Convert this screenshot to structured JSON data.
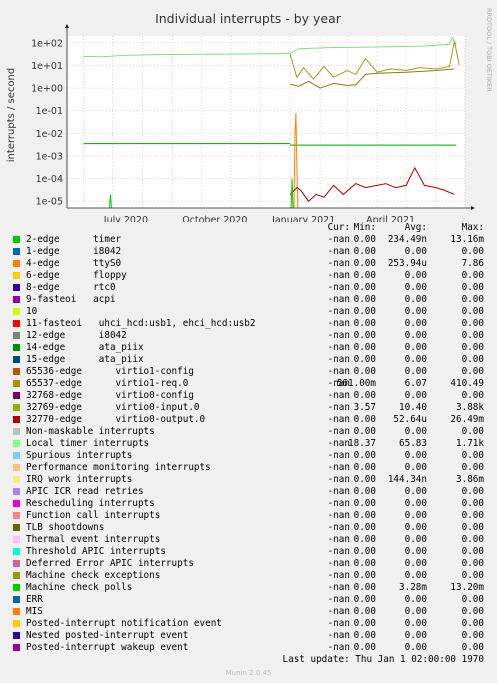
{
  "chart_data": {
    "type": "line",
    "title": "Individual interrupts - by year",
    "ylabel": "interrupts / second",
    "side_label": "RRDTOOL / TOBI OETIKER",
    "y_scale": "log",
    "ylim": [
      5e-06,
      200
    ],
    "y_ticks": [
      "1e+02",
      "1e+01",
      "1e+00",
      "1e-01",
      "1e-02",
      "1e-03",
      "1e-04",
      "1e-05"
    ],
    "x_ticks": [
      "July 2020",
      "October 2020",
      "January 2021",
      "April 2021"
    ],
    "xlim": [
      "2020-05-15",
      "2021-07-01"
    ],
    "series": [
      {
        "name": "Local timer interrupts",
        "color": "#7fe07f",
        "segments": [
          {
            "x": [
              "2020-06-01",
              "2020-06-20",
              "2020-07-15",
              "2020-08-20",
              "2020-10-01",
              "2020-11-15",
              "2020-12-15",
              "2021-01-01",
              "2021-01-10",
              "2021-02-15",
              "2021-04-01",
              "2021-05-15",
              "2021-06-15",
              "2021-06-18",
              "2021-06-22"
            ],
            "y": [
              25,
              24,
              28,
              30,
              31,
              32,
              33,
              34,
              55,
              62,
              65,
              70,
              85,
              170,
              80
            ]
          }
        ]
      },
      {
        "name": "virtio1-req.0",
        "color": "#a09c20",
        "segments": [
          {
            "x": [
              "2021-01-01",
              "2021-01-08",
              "2021-01-15",
              "2021-01-25",
              "2021-02-05",
              "2021-02-15",
              "2021-03-01",
              "2021-03-10",
              "2021-03-20",
              "2021-04-01",
              "2021-04-15",
              "2021-05-01",
              "2021-05-15",
              "2021-06-01",
              "2021-06-15",
              "2021-06-20",
              "2021-06-25"
            ],
            "y": [
              30,
              3,
              8,
              2.5,
              9,
              3,
              6,
              4,
              20,
              5,
              7,
              6,
              8,
              7,
              9,
              120,
              10
            ]
          }
        ]
      },
      {
        "name": "virtio0-input.0",
        "color": "#8a7a10",
        "segments": [
          {
            "x": [
              "2021-01-01",
              "2021-01-10",
              "2021-01-20",
              "2021-02-01",
              "2021-02-15",
              "2021-03-01",
              "2021-03-10",
              "2021-03-20",
              "2021-04-01",
              "2021-05-01",
              "2021-06-01",
              "2021-06-20"
            ],
            "y": [
              1.5,
              1.2,
              2,
              1,
              1.6,
              1.3,
              1.4,
              4,
              4.5,
              5,
              6,
              7
            ]
          }
        ]
      },
      {
        "name": "timer",
        "color": "#00a000",
        "segments": [
          {
            "x": [
              "2020-06-01",
              "2021-01-01"
            ],
            "y": [
              0.0035,
              0.0035
            ]
          },
          {
            "x": [
              "2021-01-01",
              "2021-06-22"
            ],
            "y": [
              0.003,
              0.003
            ]
          }
        ]
      },
      {
        "name": "ttyS0",
        "color": "#ff8000",
        "segments": [
          {
            "x": [
              "2021-01-05",
              "2021-01-06",
              "2021-01-07",
              "2021-01-08",
              "2021-01-09"
            ],
            "y": [
              5e-06,
              0.01,
              0.08,
              0.0003,
              5e-06
            ]
          }
        ]
      },
      {
        "name": "virtio0-output.0",
        "color": "#aa0000",
        "segments": [
          {
            "x": [
              "2021-01-01",
              "2021-01-08",
              "2021-01-12",
              "2021-01-20",
              "2021-01-28",
              "2021-02-05",
              "2021-02-15",
              "2021-02-25",
              "2021-03-10",
              "2021-03-20",
              "2021-04-01",
              "2021-04-10",
              "2021-04-20",
              "2021-05-01",
              "2021-05-10",
              "2021-05-20",
              "2021-06-01",
              "2021-06-10",
              "2021-06-20"
            ],
            "y": [
              2e-05,
              4e-05,
              3e-05,
              1e-05,
              2e-05,
              1.5e-05,
              5e-05,
              2e-05,
              6e-05,
              4e-05,
              5e-05,
              6e-05,
              4e-05,
              5e-05,
              0.0003,
              5e-05,
              4e-05,
              3e-05,
              2e-05
            ]
          }
        ]
      },
      {
        "name": "12-edge",
        "color": "#00cc00",
        "segments": [
          {
            "x": [
              "2020-06-28",
              "2020-06-29",
              "2020-06-30"
            ],
            "y": [
              5e-06,
              2e-05,
              5e-06
            ]
          },
          {
            "x": [
              "2021-01-02",
              "2021-01-03",
              "2021-01-04"
            ],
            "y": [
              5e-06,
              0.0001,
              5e-06
            ]
          }
        ]
      }
    ]
  },
  "legend": {
    "headers": {
      "cur": "Cur:",
      "min": "Min:",
      "avg": "Avg:",
      "max": "Max:"
    },
    "rows": [
      {
        "name": "2-edge      timer",
        "color": "#00cc00",
        "cur": "-nan",
        "min": "0.00",
        "avg": "234.49n",
        "max": "13.16m"
      },
      {
        "name": "1-edge      i8042",
        "color": "#0066b3",
        "cur": "-nan",
        "min": "0.00",
        "avg": "0.00",
        "max": "0.00"
      },
      {
        "name": "4-edge      ttyS0",
        "color": "#ff8000",
        "cur": "-nan",
        "min": "0.00",
        "avg": "253.94u",
        "max": "7.86"
      },
      {
        "name": "6-edge      floppy",
        "color": "#ffcc00",
        "cur": "-nan",
        "min": "0.00",
        "avg": "0.00",
        "max": "0.00"
      },
      {
        "name": "8-edge      rtc0",
        "color": "#330099",
        "cur": "-nan",
        "min": "0.00",
        "avg": "0.00",
        "max": "0.00"
      },
      {
        "name": "9-fasteoi   acpi",
        "color": "#990099",
        "cur": "-nan",
        "min": "0.00",
        "avg": "0.00",
        "max": "0.00"
      },
      {
        "name": "10",
        "color": "#ccff00",
        "cur": "-nan",
        "min": "0.00",
        "avg": "0.00",
        "max": "0.00"
      },
      {
        "name": "11-fasteoi   uhci_hcd:usb1, ehci_hcd:usb2",
        "color": "#ff0000",
        "cur": "-nan",
        "min": "0.00",
        "avg": "0.00",
        "max": "0.00"
      },
      {
        "name": "12-edge      i8042",
        "color": "#808080",
        "cur": "-nan",
        "min": "0.00",
        "avg": "0.00",
        "max": "0.00"
      },
      {
        "name": "14-edge      ata_piix",
        "color": "#008f00",
        "cur": "-nan",
        "min": "0.00",
        "avg": "0.00",
        "max": "0.00"
      },
      {
        "name": "15-edge      ata_piix",
        "color": "#00487d",
        "cur": "-nan",
        "min": "0.00",
        "avg": "0.00",
        "max": "0.00"
      },
      {
        "name": "65536-edge      virtio1-config",
        "color": "#b35a00",
        "cur": "-nan",
        "min": "0.00",
        "avg": "0.00",
        "max": "0.00"
      },
      {
        "name": "65537-edge      virtio1-req.0",
        "color": "#b38f00",
        "cur": "-nan",
        "min": "561.00m",
        "avg": "6.07",
        "max": "410.49"
      },
      {
        "name": "32768-edge      virtio0-config",
        "color": "#6b006b",
        "cur": "-nan",
        "min": "0.00",
        "avg": "0.00",
        "max": "0.00"
      },
      {
        "name": "32769-edge      virtio0-input.0",
        "color": "#8fb300",
        "cur": "-nan",
        "min": "3.57",
        "avg": "10.40",
        "max": "3.88k"
      },
      {
        "name": "32770-edge      virtio0-output.0",
        "color": "#b30000",
        "cur": "-nan",
        "min": "0.00",
        "avg": "52.64u",
        "max": "26.49m"
      },
      {
        "name": "Non-maskable interrupts",
        "color": "#bebebe",
        "cur": "-nan",
        "min": "0.00",
        "avg": "0.00",
        "max": "0.00"
      },
      {
        "name": "Local timer interrupts",
        "color": "#80ff80",
        "cur": "-nan",
        "min": "18.37",
        "avg": "65.83",
        "max": "1.71k"
      },
      {
        "name": "Spurious interrupts",
        "color": "#80c9ff",
        "cur": "-nan",
        "min": "0.00",
        "avg": "0.00",
        "max": "0.00"
      },
      {
        "name": "Performance monitoring interrupts",
        "color": "#ffc080",
        "cur": "-nan",
        "min": "0.00",
        "avg": "0.00",
        "max": "0.00"
      },
      {
        "name": "IRQ work interrupts",
        "color": "#ffe680",
        "cur": "-nan",
        "min": "0.00",
        "avg": "144.34n",
        "max": "3.86m"
      },
      {
        "name": "APIC ICR read retries",
        "color": "#aa80ff",
        "cur": "-nan",
        "min": "0.00",
        "avg": "0.00",
        "max": "0.00"
      },
      {
        "name": "Rescheduling interrupts",
        "color": "#ee00cc",
        "cur": "-nan",
        "min": "0.00",
        "avg": "0.00",
        "max": "0.00"
      },
      {
        "name": "Function call interrupts",
        "color": "#ff8080",
        "cur": "-nan",
        "min": "0.00",
        "avg": "0.00",
        "max": "0.00"
      },
      {
        "name": "TLB shootdowns",
        "color": "#666600",
        "cur": "-nan",
        "min": "0.00",
        "avg": "0.00",
        "max": "0.00"
      },
      {
        "name": "Thermal event interrupts",
        "color": "#ffbfff",
        "cur": "-nan",
        "min": "0.00",
        "avg": "0.00",
        "max": "0.00"
      },
      {
        "name": "Threshold APIC interrupts",
        "color": "#00ffcc",
        "cur": "-nan",
        "min": "0.00",
        "avg": "0.00",
        "max": "0.00"
      },
      {
        "name": "Deferred Error APIC interrupts",
        "color": "#cc6699",
        "cur": "-nan",
        "min": "0.00",
        "avg": "0.00",
        "max": "0.00"
      },
      {
        "name": "Machine check exceptions",
        "color": "#999900",
        "cur": "-nan",
        "min": "0.00",
        "avg": "0.00",
        "max": "0.00"
      },
      {
        "name": "Machine check polls",
        "color": "#00cc00",
        "cur": "-nan",
        "min": "0.00",
        "avg": "3.28m",
        "max": "13.20m"
      },
      {
        "name": "ERR",
        "color": "#0066b3",
        "cur": "-nan",
        "min": "0.00",
        "avg": "0.00",
        "max": "0.00"
      },
      {
        "name": "MIS",
        "color": "#ff8000",
        "cur": "-nan",
        "min": "0.00",
        "avg": "0.00",
        "max": "0.00"
      },
      {
        "name": "Posted-interrupt notification event",
        "color": "#ffcc00",
        "cur": "-nan",
        "min": "0.00",
        "avg": "0.00",
        "max": "0.00"
      },
      {
        "name": "Nested posted-interrupt event",
        "color": "#330099",
        "cur": "-nan",
        "min": "0.00",
        "avg": "0.00",
        "max": "0.00"
      },
      {
        "name": "Posted-interrupt wakeup event",
        "color": "#990099",
        "cur": "-nan",
        "min": "0.00",
        "avg": "0.00",
        "max": "0.00"
      }
    ]
  },
  "footer": {
    "last_update": "Last update:  Thu Jan  1 02:00:00 1970",
    "munin_version": "Munin 2.0.45"
  }
}
